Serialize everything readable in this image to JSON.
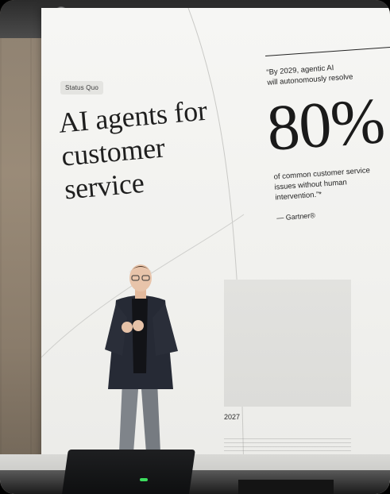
{
  "slide": {
    "tag": "Status Quo",
    "headline": [
      "AI agents for",
      "customer",
      "service"
    ],
    "quote_lines": [
      "“By 2029, agentic AI",
      "will autonomously resolve"
    ],
    "big_number": "80%",
    "description_lines": [
      "of common customer service",
      "issues without human",
      "intervention.”*"
    ],
    "attribution": "— Gartner®",
    "year": "2027"
  },
  "colors": {
    "slide_background": "#f3f3f1",
    "text": "#1f1f1f",
    "chip_background": "#e4e4e1",
    "indicator_led": "#3cdc5e"
  }
}
